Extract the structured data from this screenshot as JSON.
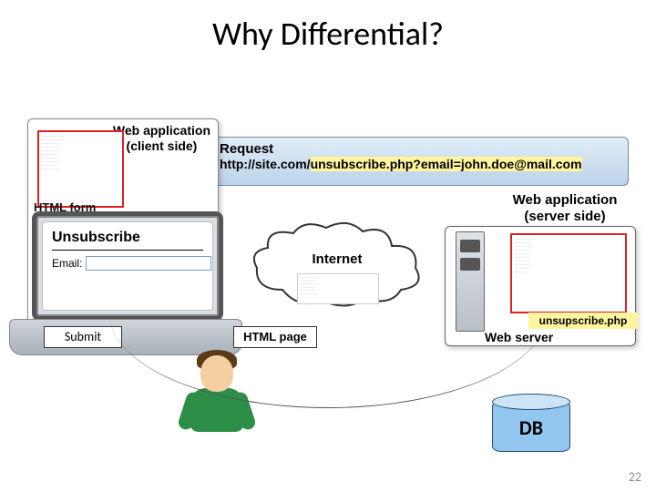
{
  "title": "Why Differential?",
  "request": {
    "label": "Request",
    "url_prefix": "http://site.com/",
    "url_highlight": "unsubscribe.php?email=john.doe@mail.com"
  },
  "client": {
    "heading_line1": "Web application",
    "heading_line2": "(client side)",
    "html_form_label": "HTML form",
    "form_title": "Unsubscribe",
    "email_label": "Email:",
    "submit_label": "Submit"
  },
  "internet_label": "Internet",
  "html_page_label": "HTML page",
  "server": {
    "heading_line1": "Web application",
    "heading_line2": "(server side)",
    "php_file": "unsupscribe.php",
    "web_server_label": "Web server"
  },
  "db_label": "DB",
  "page_number": "22"
}
